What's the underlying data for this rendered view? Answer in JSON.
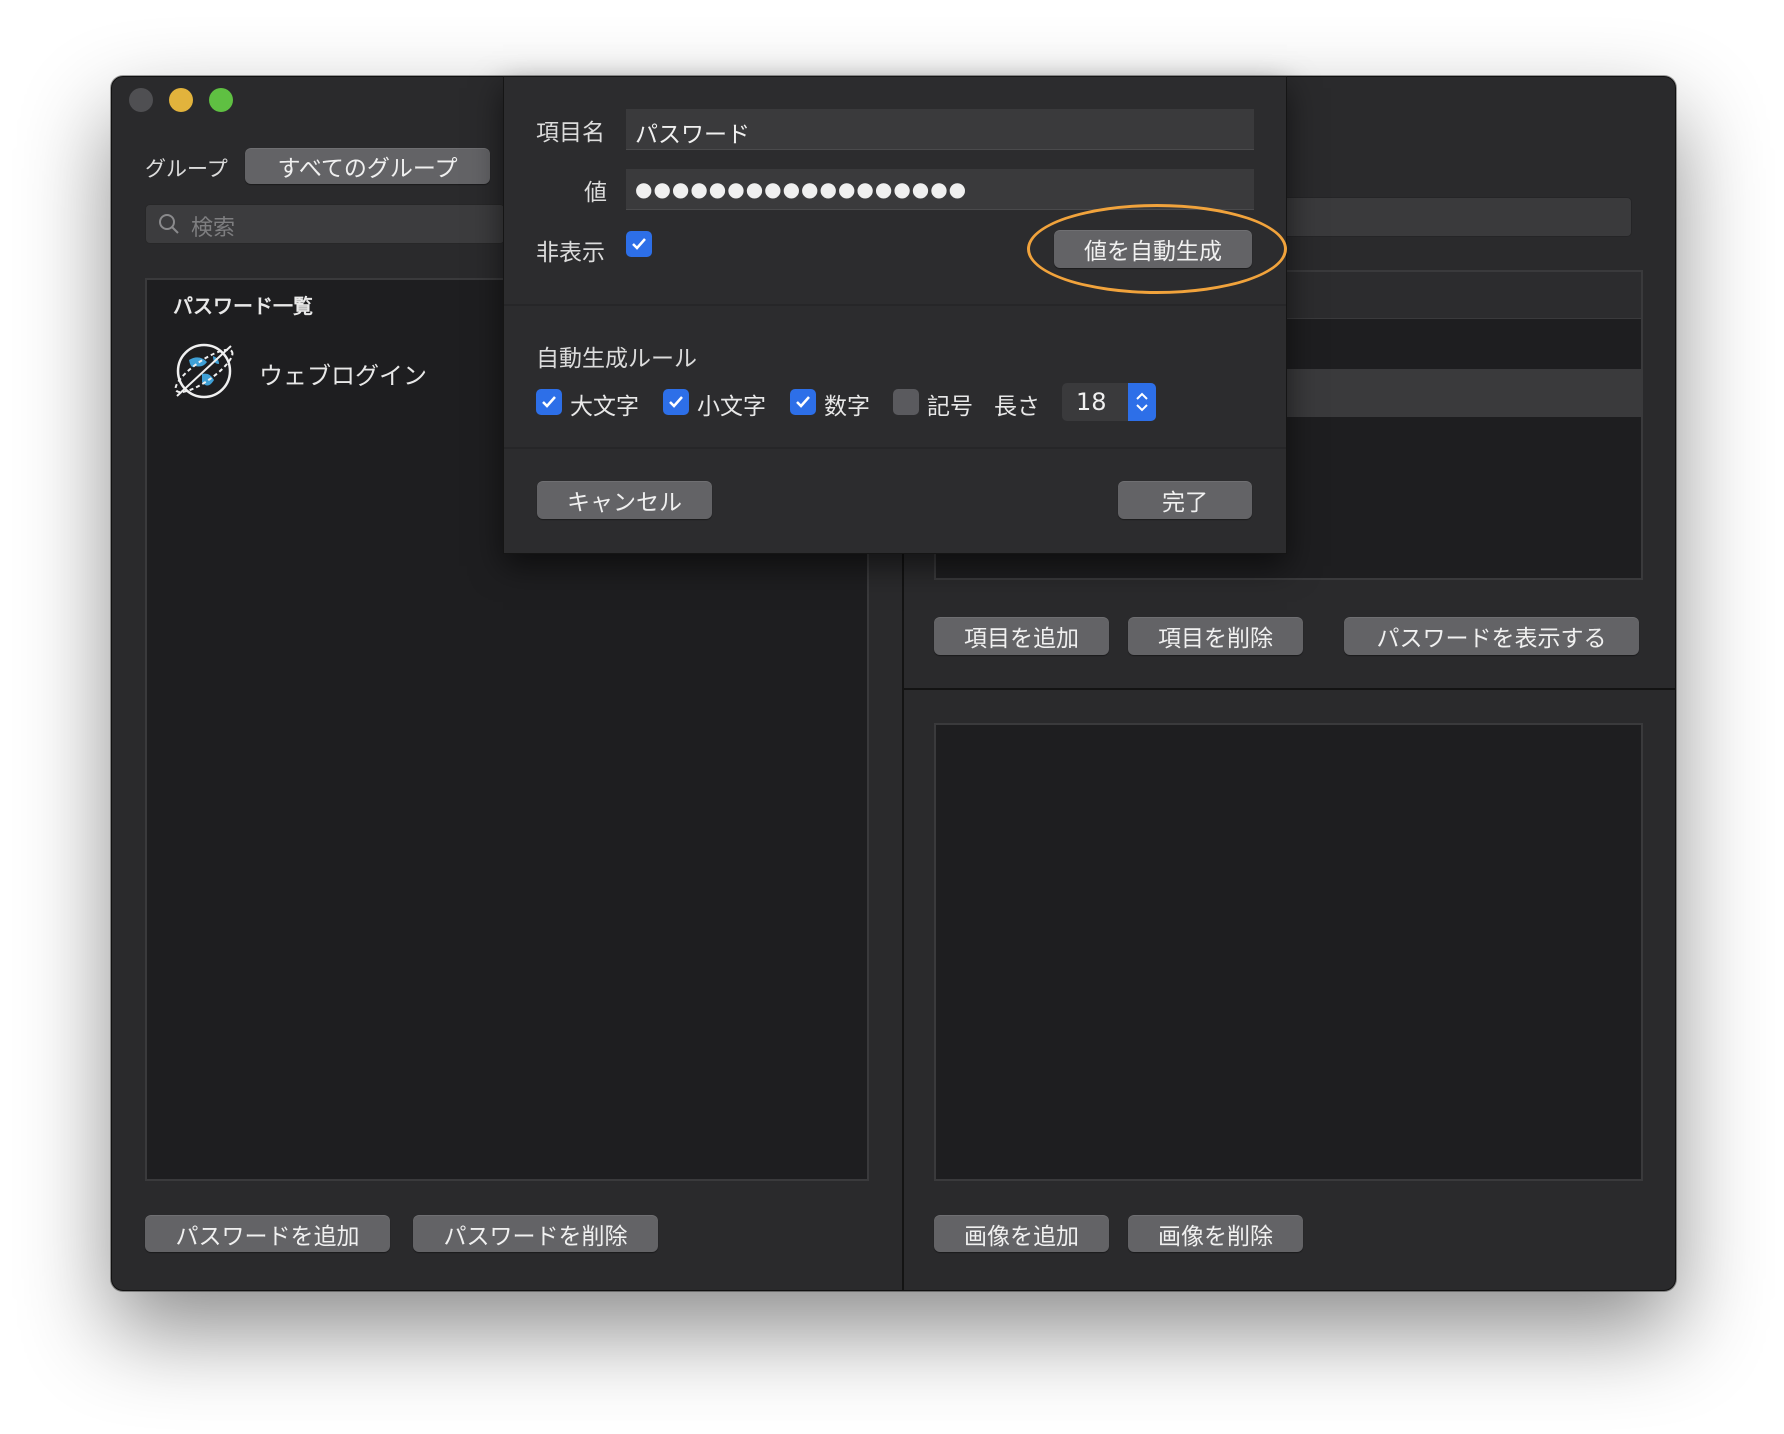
{
  "sidebar": {
    "group_label": "グループ",
    "group_selector": "すべてのグループ",
    "search_placeholder": "検索",
    "list_header": "パスワード一覧",
    "items": [
      {
        "label": "ウェブログイン",
        "icon": "globe-icon"
      }
    ],
    "add_password": "パスワードを追加",
    "delete_password": "パスワードを削除"
  },
  "detail": {
    "add_item": "項目を追加",
    "delete_item": "項目を削除",
    "show_password": "パスワードを表示する",
    "add_image": "画像を追加",
    "delete_image": "画像を削除"
  },
  "dialog": {
    "name_label": "項目名",
    "name_value": "パスワード",
    "value_label": "値",
    "value_masked": "●●●●●●●●●●●●●●●●●●",
    "hidden_label": "非表示",
    "hidden_checked": true,
    "autogen_button": "値を自動生成",
    "rules_title": "自動生成ルール",
    "rules": [
      {
        "label": "大文字",
        "checked": true
      },
      {
        "label": "小文字",
        "checked": true
      },
      {
        "label": "数字",
        "checked": true
      },
      {
        "label": "記号",
        "checked": false
      }
    ],
    "length_label": "長さ",
    "length_value": "18",
    "cancel": "キャンセル",
    "done": "完了"
  },
  "colors": {
    "accent": "#2d6fe8",
    "highlight": "#f1a33c",
    "window_bg": "#2a2a2c"
  }
}
